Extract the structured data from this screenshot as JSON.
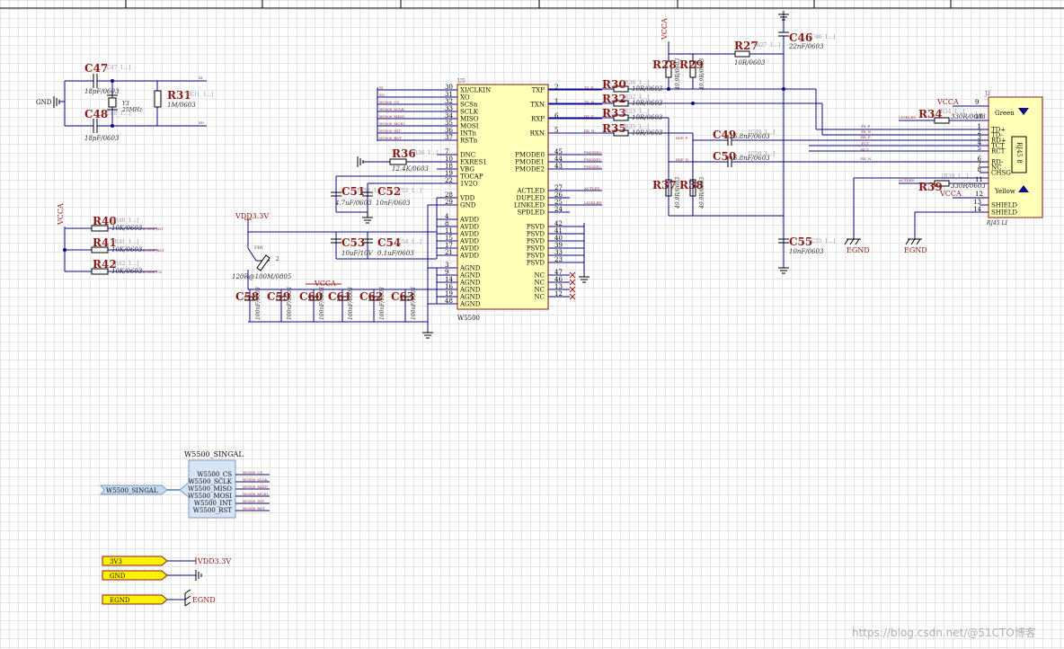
{
  "schematic": {
    "u1": {
      "designator": "U5",
      "part": "W5500",
      "left_pins": [
        {
          "num": "30",
          "name": "XI/CLKIN",
          "net": "XI"
        },
        {
          "num": "31",
          "name": "XO",
          "net": "XO"
        },
        {
          "num": "32",
          "name": "SCSn",
          "net": "W5500_CS"
        },
        {
          "num": "33",
          "name": "SCLK",
          "net": "W5500_SCLK"
        },
        {
          "num": "34",
          "name": "MISO",
          "net": "W5500_MISO"
        },
        {
          "num": "35",
          "name": "MOSI",
          "net": "W5500_MOSI"
        },
        {
          "num": "36",
          "name": "INTn",
          "net": "W5500_INT"
        },
        {
          "num": "37",
          "name": "RSTn",
          "net": "W5500_RST"
        },
        {
          "num": "7",
          "name": "DNC",
          "net": ""
        },
        {
          "num": "10",
          "name": "EXRES1",
          "net": ""
        },
        {
          "num": "18",
          "name": "VBG",
          "net": ""
        },
        {
          "num": "19",
          "name": "TOCAP",
          "net": ""
        },
        {
          "num": "22",
          "name": "1V2O",
          "net": ""
        },
        {
          "num": "28",
          "name": "VDD",
          "net": ""
        },
        {
          "num": "29",
          "name": "GND",
          "net": ""
        },
        {
          "num": "4",
          "name": "AVDD",
          "net": ""
        },
        {
          "num": "8",
          "name": "AVDD",
          "net": ""
        },
        {
          "num": "11",
          "name": "AVDD",
          "net": ""
        },
        {
          "num": "15",
          "name": "AVDD",
          "net": ""
        },
        {
          "num": "17",
          "name": "AVDD",
          "net": ""
        },
        {
          "num": "21",
          "name": "AVDD",
          "net": ""
        },
        {
          "num": "3",
          "name": "AGND",
          "net": ""
        },
        {
          "num": "9",
          "name": "AGND",
          "net": ""
        },
        {
          "num": "14",
          "name": "AGND",
          "net": ""
        },
        {
          "num": "16",
          "name": "AGND",
          "net": ""
        },
        {
          "num": "19",
          "name": "AGND",
          "net": ""
        },
        {
          "num": "48",
          "name": "AGND",
          "net": ""
        }
      ],
      "right_pins": [
        {
          "num": "2",
          "name": "TXP",
          "net": "TX_P"
        },
        {
          "num": "1",
          "name": "TXN",
          "net": "TX_N"
        },
        {
          "num": "6",
          "name": "RXP",
          "net": "RX_P"
        },
        {
          "num": "5",
          "name": "RXN",
          "net": "RX_N"
        },
        {
          "num": "45",
          "name": "PMODE0",
          "net": "PMODE0"
        },
        {
          "num": "44",
          "name": "PMODE1",
          "net": "PMODE1"
        },
        {
          "num": "43",
          "name": "PMODE2",
          "net": "PMODE2"
        },
        {
          "num": "27",
          "name": "ACTLED",
          "net": "ACTLED"
        },
        {
          "num": "26",
          "name": "DUPLED",
          "net": ""
        },
        {
          "num": "25",
          "name": "LINKLED",
          "net": "LINKLED"
        },
        {
          "num": "24",
          "name": "SPDLED",
          "net": ""
        },
        {
          "num": "42",
          "name": "PSVD",
          "net": ""
        },
        {
          "num": "41",
          "name": "PSVD",
          "net": ""
        },
        {
          "num": "40",
          "name": "PSVD",
          "net": ""
        },
        {
          "num": "39",
          "name": "PSVD",
          "net": ""
        },
        {
          "num": "33",
          "name": "PSVD",
          "net": ""
        },
        {
          "num": "23",
          "name": "PSVD",
          "net": ""
        },
        {
          "num": "47",
          "name": "NC",
          "net": ""
        },
        {
          "num": "46",
          "name": "NC",
          "net": ""
        },
        {
          "num": "13",
          "name": "NC",
          "net": ""
        },
        {
          "num": "12",
          "name": "NC",
          "net": ""
        }
      ]
    },
    "crystal": {
      "c47": {
        "des": "C47",
        "val": "18pF/0603",
        "com": "[C47_1...]"
      },
      "c48": {
        "des": "C48",
        "val": "18pF/0603",
        "com": "[C48_1...]"
      },
      "y3": {
        "des": "Y3",
        "val": "25MHz"
      },
      "r31": {
        "des": "R31",
        "val": "1M/0603",
        "com": "[R31_1...]"
      },
      "gnd": "GND",
      "xi": "XI",
      "xo": "XO"
    },
    "pullups": {
      "vcca": "VCCA",
      "rows": [
        {
          "des": "R40",
          "val": "10K/0603",
          "com": "[R40_1...]",
          "net": "W5500_INT"
        },
        {
          "des": "R41",
          "val": "10K/0603",
          "com": "[R41_1...]",
          "net": "W5500_RST"
        },
        {
          "des": "R42",
          "val": "10K/0603",
          "com": "[R42_1...]",
          "net": "W5500_CS"
        }
      ]
    },
    "bias": {
      "r36": {
        "des": "R36",
        "val": "12.4K/0603",
        "com": "[R36_1...]"
      },
      "c51": {
        "des": "C51",
        "val": "4.7uF/0603",
        "com": "[C51_1...]"
      },
      "c52": {
        "des": "C52",
        "val": "10nF/0603",
        "com": "[C52_1...]"
      },
      "c53": {
        "des": "C53",
        "val": "10uF/10V",
        "com": "[C53_1...]"
      },
      "c54": {
        "des": "C54",
        "val": "0.1uF/0603",
        "com": "[C54_1...]"
      }
    },
    "power": {
      "vdd33": "VDD3.3V",
      "fb": {
        "des": "FB1",
        "val": "120R@100M/0805",
        "pin2": "2"
      },
      "vcca": "VCCA",
      "caps": [
        {
          "des": "C58",
          "val": "100nF/0603"
        },
        {
          "des": "C59",
          "val": "100nF/0603"
        },
        {
          "des": "C60",
          "val": "100nF/0603"
        },
        {
          "des": "C61",
          "val": "100nF/0603"
        },
        {
          "des": "C62",
          "val": "100nF/0603"
        },
        {
          "des": "C63",
          "val": "100nF/0603"
        }
      ]
    },
    "termination": {
      "vcca": "VCCA",
      "r28": {
        "des": "R28",
        "val": "49.9R/0603"
      },
      "r29": {
        "des": "R29",
        "val": "49.9R/0603"
      },
      "r27": {
        "des": "R27",
        "val": "10R/0603",
        "com": "[R27_1...]"
      },
      "c46": {
        "des": "C46",
        "val": "22nF/0603",
        "com": "[C46_1...]"
      },
      "r30": {
        "des": "R30",
        "val": "10R/0603",
        "com": "[R30_1...]"
      },
      "r32": {
        "des": "R32",
        "val": "10R/0603",
        "com": "[R32_1...]"
      },
      "r33": {
        "des": "R33",
        "val": "10R/0603",
        "com": "[R33_1...]"
      },
      "r35": {
        "des": "R35",
        "val": "10R/0603",
        "com": "[R35_1...]"
      },
      "c49": {
        "des": "C49",
        "val": "6.8nF/0603",
        "com": "[C49_1...]"
      },
      "c50": {
        "des": "C50",
        "val": "6.8nF/0603",
        "com": "[C50_1...]"
      },
      "r37": {
        "des": "R37",
        "val": "49.9R/0603"
      },
      "r38": {
        "des": "R38",
        "val": "49.9R/0603"
      },
      "c55": {
        "des": "C55",
        "val": "10nF/0603",
        "com": "[C55_1...]"
      },
      "rxp_label": "RXP_P",
      "rxn_label": "RXP_N"
    },
    "rj45": {
      "des": "J2",
      "part": "RJ45 LI",
      "inner": "RJ45 8",
      "pins": [
        {
          "num": "1",
          "name": "TD+"
        },
        {
          "num": "2",
          "name": "TD-"
        },
        {
          "num": "3",
          "name": "RD+"
        },
        {
          "num": "4",
          "name": "TCT"
        },
        {
          "num": "5",
          "name": "RCT"
        },
        {
          "num": "6",
          "name": "RD-"
        },
        {
          "num": "7",
          "name": "NC"
        },
        {
          "num": "8",
          "name": "CHSG"
        },
        {
          "num": "13",
          "name": "SHIELD"
        },
        {
          "num": "14",
          "name": "SHIELD"
        }
      ],
      "led_top": {
        "name": "Green",
        "p1": "9",
        "p2": "10"
      },
      "led_bot": {
        "name": "Yellow",
        "p1": "11",
        "p2": "12"
      },
      "r34": {
        "des": "R34",
        "val": "330R/0603",
        "com": "[R34_1...]"
      },
      "r39": {
        "des": "R39",
        "val": "330R/0603",
        "com": "[R39_1...]"
      },
      "vcca1": "VCCA",
      "vcca2": "VCCA",
      "egnd1": "EGND",
      "egnd2": "EGND",
      "linkled": "LINKLED",
      "actled": "ACTLED",
      "tx_p": "TX_P",
      "tx_n": "TX_N",
      "rx_p": "RX_P",
      "tct": "TCT",
      "rct": "RCT",
      "rx_n": "RX_N"
    },
    "harness": {
      "title": "W5500_SINGAL",
      "port": "W5500_SINGAL",
      "signals": [
        "W5500_CS",
        "W5500_SCLK",
        "W5500_MISO",
        "W5500_MOSI",
        "W5500_INT",
        "W5500_RST"
      ]
    },
    "ports": {
      "p3v3": "3V3",
      "vdd": "VDD3.3V",
      "gnd": "GND",
      "egnd": "EGND",
      "egnd_sym": "EGND"
    },
    "watermark": "https://blog.csdn.net/@51CTO博客"
  }
}
